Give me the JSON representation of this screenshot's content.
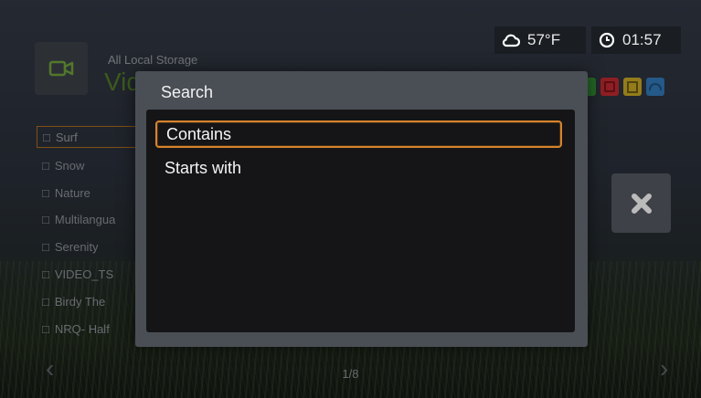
{
  "status": {
    "temperature": "57°F",
    "time": "01:57",
    "weather_icon": "cloud-icon",
    "clock_icon": "clock-icon"
  },
  "background": {
    "subtitle": "All Local Storage",
    "title": "Vid",
    "list": [
      {
        "label": "Surf",
        "selected": true
      },
      {
        "label": "Snow"
      },
      {
        "label": "Nature"
      },
      {
        "label": "Multilangua"
      },
      {
        "label": "Serenity"
      },
      {
        "label": "VIDEO_TS"
      },
      {
        "label": "Birdy The"
      },
      {
        "label": "NRQ- Half"
      }
    ],
    "page": "1/8",
    "color_keys": [
      {
        "color": "#2e8b2e",
        "icon": "green-key"
      },
      {
        "color": "#c0282d",
        "icon": "red-key-icon"
      },
      {
        "color": "#c9a820",
        "icon": "yellow-key-icon"
      },
      {
        "color": "#2f78b8",
        "icon": "blue-key-icon"
      }
    ]
  },
  "dialog": {
    "title": "Search",
    "options": [
      {
        "label": "Contains"
      },
      {
        "label": "Starts with"
      }
    ]
  },
  "colors": {
    "highlight": "#d7842b",
    "title_green": "#4f7a22"
  }
}
